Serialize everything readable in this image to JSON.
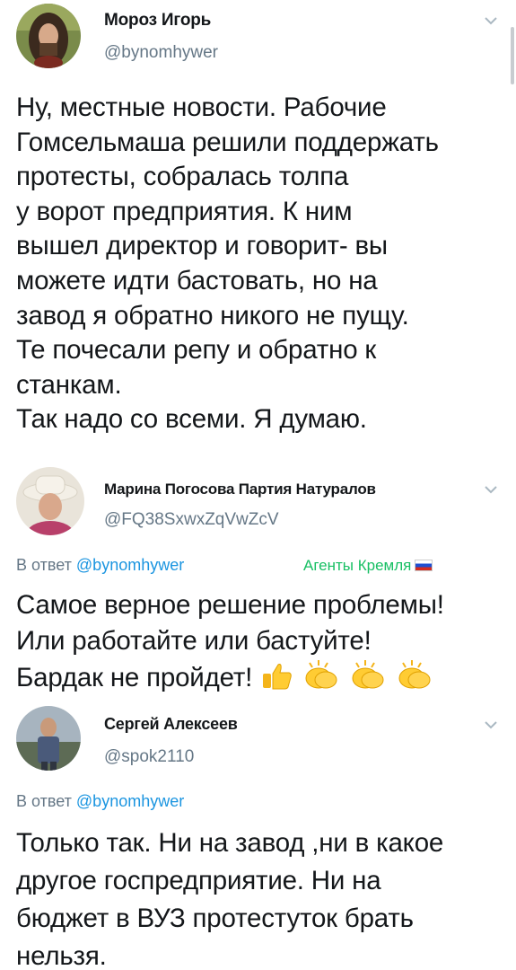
{
  "tweets": [
    {
      "name": "Мороз Игорь",
      "handle": "@bynomhywer",
      "lines": [
        "Ну, местные новости. Рабочие",
        "Гомсельмаша решили поддержать",
        "протесты, собралась толпа",
        "у ворот предприятия. К ним",
        "вышел директор и говорит- вы",
        "можете идти бастовать, но на",
        "завод я обратно никого не пущу.",
        "Те почесали репу и обратно к",
        "станкам.",
        "Так надо со всеми. Я думаю."
      ]
    },
    {
      "name": "Марина Погосова Партия Натуралов",
      "handle": "@FQ38SxwxZqVwZcV",
      "reply_prefix": "В ответ",
      "reply_to": "@bynomhywer",
      "side_label": "Агенты Кремля",
      "lines": [
        "Самое верное решение проблемы!",
        "Или работайте или бастуйте!",
        "Бардак не пройдет!"
      ],
      "emojis": [
        "thumbs-up-icon",
        "clapping-hands-icon",
        "clapping-hands-icon",
        "clapping-hands-icon"
      ]
    },
    {
      "name": "Сергей Алексеев",
      "handle": "@spok2110",
      "reply_prefix": "В ответ",
      "reply_to": "@bynomhywer",
      "lines": [
        "Только так. Ни на завод ,ни в какое",
        "другое госпредприятие. Ни на",
        "бюджет в ВУЗ протестуток брать",
        "нельзя."
      ]
    }
  ],
  "colors": {
    "text": "#14171a",
    "secondary": "#657786",
    "link": "#1b95e0",
    "label_green": "#17bf63"
  }
}
